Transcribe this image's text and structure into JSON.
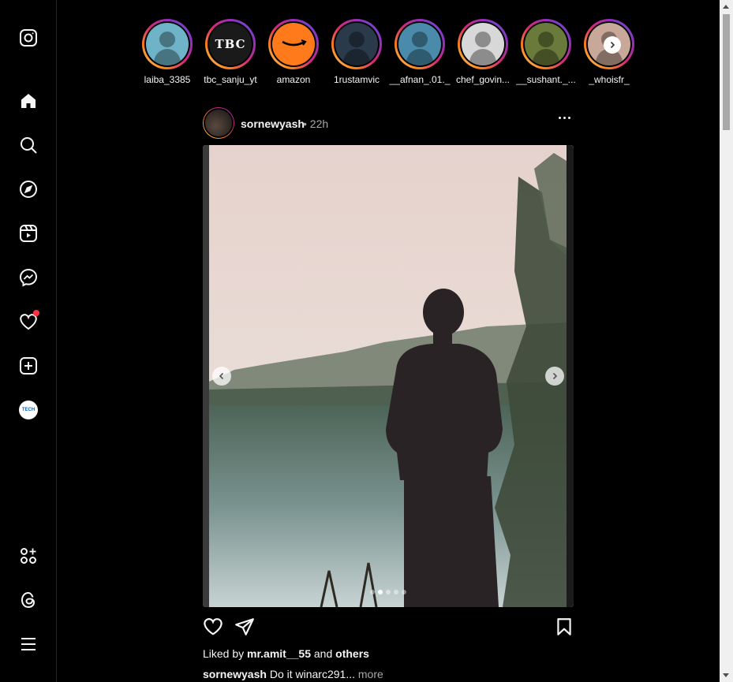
{
  "sidebar": {
    "items": [
      {
        "name": "instagram-logo-icon"
      },
      {
        "name": "home-icon"
      },
      {
        "name": "search-icon"
      },
      {
        "name": "explore-icon"
      },
      {
        "name": "reels-icon"
      },
      {
        "name": "messenger-icon"
      },
      {
        "name": "notifications-heart-icon"
      },
      {
        "name": "create-plus-icon"
      },
      {
        "name": "profile-avatar"
      },
      {
        "name": "also-from-meta-icon"
      },
      {
        "name": "threads-icon"
      },
      {
        "name": "menu-icon"
      }
    ],
    "profile_text": "TECH"
  },
  "stories": [
    {
      "username": "laiba_3385",
      "color": "#6fb3c8"
    },
    {
      "username": "tbc_sanju_yt",
      "color": "#1a1a1a",
      "logo": "TBC"
    },
    {
      "username": "amazon",
      "color": "#ff7a1a"
    },
    {
      "username": "1rustamvic",
      "color": "#2a3a4a"
    },
    {
      "username": "__afnan_.01._",
      "color": "#4a8aaa"
    },
    {
      "username": "chef_govin...",
      "color": "#d8d8d8"
    },
    {
      "username": "__sushant._...",
      "color": "#6a7a3a"
    },
    {
      "username": "_whoisfr_",
      "color": "#c8a898"
    }
  ],
  "post": {
    "username": "sornewyash",
    "time": "22h",
    "separator": "•",
    "carousel": {
      "total": 5,
      "active": 1
    },
    "likes": {
      "prefix": "Liked by",
      "user": "mr.amit__55",
      "mid": "and",
      "others": "others"
    },
    "caption": {
      "user": "sornewyash",
      "text": "Do it winarc291...",
      "more": "more"
    }
  }
}
